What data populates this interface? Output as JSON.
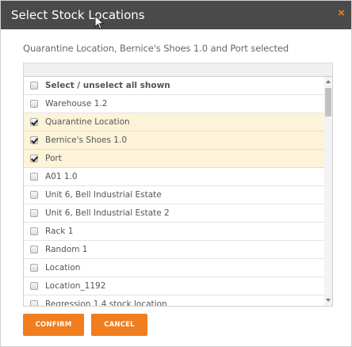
{
  "dialog": {
    "title": "Select Stock Locations",
    "close_label": "×"
  },
  "summary": "Quarantine Location, Bernice's Shoes 1.0 and Port selected",
  "filter": {
    "value": ""
  },
  "list": {
    "select_all_label": "Select / unselect all shown",
    "items": [
      {
        "label": "Warehouse 1.2",
        "checked": false
      },
      {
        "label": "Quarantine Location",
        "checked": true
      },
      {
        "label": "Bernice's Shoes 1.0",
        "checked": true
      },
      {
        "label": "Port",
        "checked": true
      },
      {
        "label": "A01 1.0",
        "checked": false
      },
      {
        "label": "Unit 6, Bell Industrial Estate",
        "checked": false
      },
      {
        "label": "Unit 6, Bell Industrial Estate 2",
        "checked": false
      },
      {
        "label": "Rack 1",
        "checked": false
      },
      {
        "label": "Random 1",
        "checked": false
      },
      {
        "label": "Location",
        "checked": false
      },
      {
        "label": "Location_1192",
        "checked": false
      },
      {
        "label": "Regression 1.4 stock location",
        "checked": false
      },
      {
        "label": "",
        "checked": false
      }
    ]
  },
  "buttons": {
    "confirm_label": "CONFIRM",
    "cancel_label": "CANCEL"
  },
  "colors": {
    "titlebar": "#4a4a4a",
    "accent": "#f07d1e",
    "selected_row": "#fcf3d8"
  }
}
